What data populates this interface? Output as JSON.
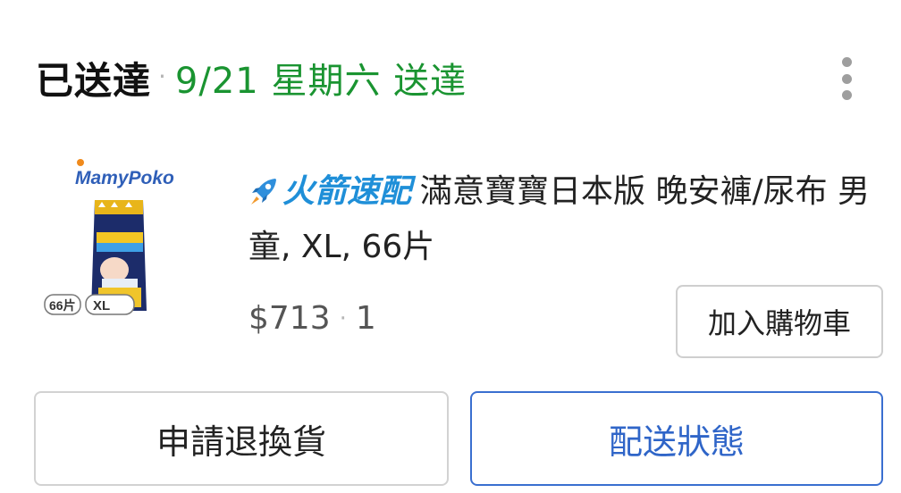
{
  "header": {
    "status": "已送達",
    "separator": "·",
    "delivery_date": "9/21 星期六 送達",
    "more_icon": "more-vertical-icon"
  },
  "product": {
    "image_brand": "MamyPoko",
    "image_count_label": "66片",
    "image_size_label": "XL",
    "badge": "火箭速配",
    "badge_color": "#1f8fd8",
    "name": "滿意寶寶日本版 晚安褲/尿布 男童, XL, 66片",
    "price": "$713",
    "separator": "·",
    "quantity": "1",
    "add_to_cart_label": "加入購物車"
  },
  "actions": {
    "return_label": "申請退換貨",
    "track_label": "配送狀態"
  },
  "colors": {
    "delivered_green": "#1a9431",
    "primary_blue": "#2f65c8"
  }
}
